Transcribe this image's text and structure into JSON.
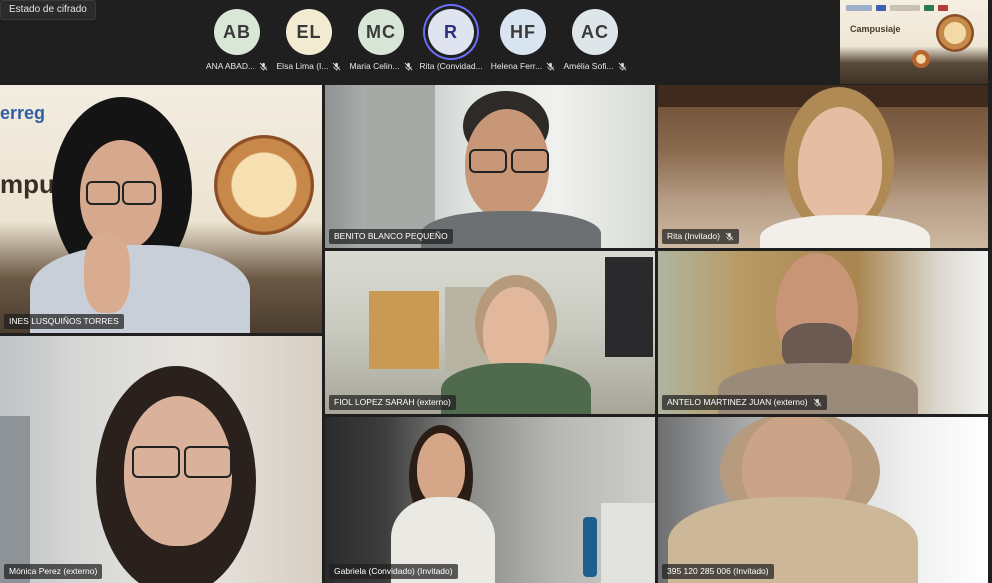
{
  "top": {
    "encryption_status": "Estado de cifrado",
    "participants": [
      {
        "initials": "AB",
        "name": "ANA ABAD...",
        "color": "#d9e8d6",
        "muted": true
      },
      {
        "initials": "EL",
        "name": "Elsa Lima (I...",
        "color": "#f3ead2",
        "muted": true
      },
      {
        "initials": "MC",
        "name": "Maria Celin...",
        "color": "#d8e6d8",
        "muted": true
      },
      {
        "initials": "R",
        "name": "Rita (Convidad...",
        "color": "#dfe4f0",
        "muted": false
      },
      {
        "initials": "HF",
        "name": "Helena Ferr...",
        "color": "#d8e4ef",
        "muted": true
      },
      {
        "initials": "AC",
        "name": "Amélia Sofi...",
        "color": "#dfe6ea",
        "muted": true
      }
    ],
    "shared_content_title": "Campusiaje"
  },
  "tiles": [
    {
      "name": "INES LUSQUIÑOS TORRES",
      "muted": false,
      "bg_text": "erreg",
      "bg_text2": "mpus"
    },
    {
      "name": "BENITO BLANCO PEQUEÑO",
      "muted": false
    },
    {
      "name": "Rita (Invitado)",
      "muted": true
    },
    {
      "name": "FIOL LOPEZ SARAH (externo)",
      "muted": false,
      "active": true
    },
    {
      "name": "ANTELO MARTINEZ JUAN (externo)",
      "muted": true
    },
    {
      "name": "Mónica Perez (externo)",
      "muted": false
    },
    {
      "name": "Gabriela (Convidado) (Invitado)",
      "muted": false
    },
    {
      "name": "395 120 285 006 (Invitado)",
      "muted": false
    }
  ],
  "colors": {
    "accent_active": "#8a8cf5",
    "toolbar_bg": "#1f1f1f"
  }
}
